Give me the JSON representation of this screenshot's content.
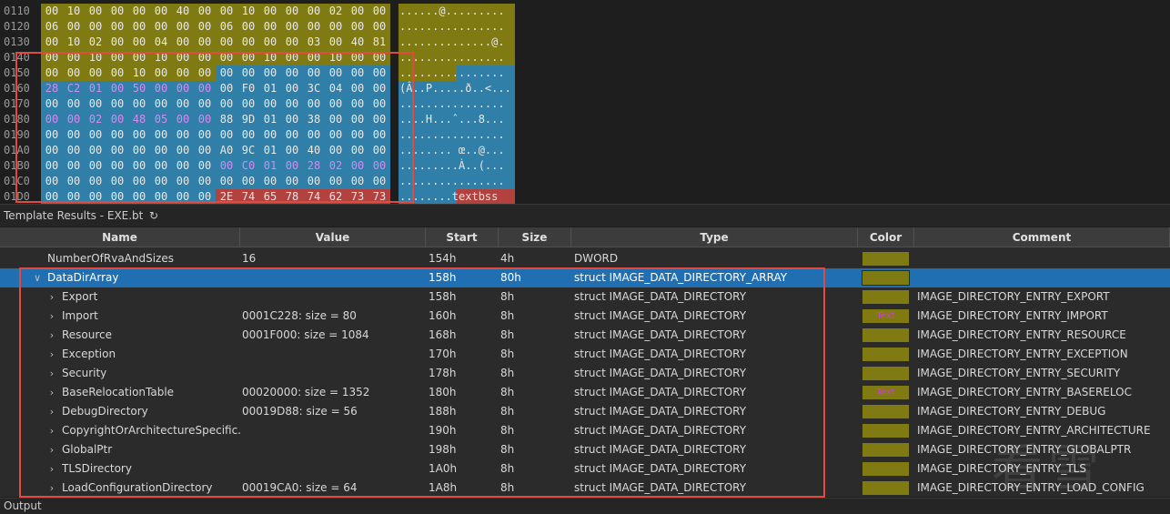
{
  "hex_view": {
    "rows": [
      {
        "addr": "0110",
        "bytes": [
          "00",
          "10",
          "00",
          "00",
          "00",
          "00",
          "40",
          "00",
          "00",
          "10",
          "00",
          "00",
          "00",
          "02",
          "00",
          "00"
        ],
        "ascii": "......@........."
      },
      {
        "addr": "0120",
        "bytes": [
          "06",
          "00",
          "00",
          "00",
          "00",
          "00",
          "00",
          "00",
          "06",
          "00",
          "00",
          "00",
          "00",
          "00",
          "00",
          "00"
        ],
        "ascii": "................"
      },
      {
        "addr": "0130",
        "bytes": [
          "00",
          "10",
          "02",
          "00",
          "00",
          "04",
          "00",
          "00",
          "00",
          "00",
          "00",
          "00",
          "03",
          "00",
          "40",
          "81"
        ],
        "ascii": "..............@."
      },
      {
        "addr": "0140",
        "bytes": [
          "00",
          "00",
          "10",
          "00",
          "00",
          "10",
          "00",
          "00",
          "00",
          "00",
          "10",
          "00",
          "00",
          "10",
          "00",
          "00"
        ],
        "ascii": "................"
      },
      {
        "addr": "0150",
        "bytes": [
          "00",
          "00",
          "00",
          "00",
          "10",
          "00",
          "00",
          "00",
          "00",
          "00",
          "00",
          "00",
          "00",
          "00",
          "00",
          "00"
        ],
        "ascii": "................"
      },
      {
        "addr": "0160",
        "bytes": [
          "28",
          "C2",
          "01",
          "00",
          "50",
          "00",
          "00",
          "00",
          "00",
          "F0",
          "01",
          "00",
          "3C",
          "04",
          "00",
          "00"
        ],
        "ascii": "(Â..P.....ð..<..."
      },
      {
        "addr": "0170",
        "bytes": [
          "00",
          "00",
          "00",
          "00",
          "00",
          "00",
          "00",
          "00",
          "00",
          "00",
          "00",
          "00",
          "00",
          "00",
          "00",
          "00"
        ],
        "ascii": "................"
      },
      {
        "addr": "0180",
        "bytes": [
          "00",
          "00",
          "02",
          "00",
          "48",
          "05",
          "00",
          "00",
          "88",
          "9D",
          "01",
          "00",
          "38",
          "00",
          "00",
          "00"
        ],
        "ascii": "....H...ˆ...8..."
      },
      {
        "addr": "0190",
        "bytes": [
          "00",
          "00",
          "00",
          "00",
          "00",
          "00",
          "00",
          "00",
          "00",
          "00",
          "00",
          "00",
          "00",
          "00",
          "00",
          "00"
        ],
        "ascii": "................"
      },
      {
        "addr": "01A0",
        "bytes": [
          "00",
          "00",
          "00",
          "00",
          "00",
          "00",
          "00",
          "00",
          "A0",
          "9C",
          "01",
          "00",
          "40",
          "00",
          "00",
          "00"
        ],
        "ascii": "........ œ..@..."
      },
      {
        "addr": "01B0",
        "bytes": [
          "00",
          "00",
          "00",
          "00",
          "00",
          "00",
          "00",
          "00",
          "00",
          "C0",
          "01",
          "00",
          "28",
          "02",
          "00",
          "00"
        ],
        "ascii": ".........À..(..."
      },
      {
        "addr": "01C0",
        "bytes": [
          "00",
          "00",
          "00",
          "00",
          "00",
          "00",
          "00",
          "00",
          "00",
          "00",
          "00",
          "00",
          "00",
          "00",
          "00",
          "00"
        ],
        "ascii": "................"
      },
      {
        "addr": "01D0",
        "bytes": [
          "00",
          "00",
          "00",
          "00",
          "00",
          "00",
          "00",
          "00",
          "2E",
          "74",
          "65",
          "78",
          "74",
          "62",
          "73",
          "73"
        ],
        "ascii": "........textbss"
      }
    ],
    "colors": {
      "olive": "#7f7a12",
      "blue": "#2f7fa8",
      "red": "#b3413d",
      "purple_text": "#d28cf2"
    }
  },
  "template": {
    "title": "Template Results - EXE.bt",
    "refresh_icon": "refresh-icon"
  },
  "table": {
    "columns": [
      "Name",
      "Value",
      "Start",
      "Size",
      "Type",
      "Color",
      "Comment"
    ],
    "rows": [
      {
        "name": "NumberOfRvaAndSizes",
        "value": "16",
        "start": "154h",
        "size": "4h",
        "type": "DWORD",
        "comment": "",
        "chevron": "",
        "text": ""
      },
      {
        "name": "DataDirArray",
        "value": "",
        "start": "158h",
        "size": "80h",
        "type": "struct IMAGE_DATA_DIRECTORY_ARRAY",
        "comment": "",
        "chevron": "v",
        "text": ""
      },
      {
        "name": "Export",
        "value": "",
        "start": "158h",
        "size": "8h",
        "type": "struct IMAGE_DATA_DIRECTORY",
        "comment": "IMAGE_DIRECTORY_ENTRY_EXPORT",
        "chevron": ">",
        "text": ""
      },
      {
        "name": "Import",
        "value": "0001C228: size = 80",
        "start": "160h",
        "size": "8h",
        "type": "struct IMAGE_DATA_DIRECTORY",
        "comment": "IMAGE_DIRECTORY_ENTRY_IMPORT",
        "chevron": ">",
        "text": "Text"
      },
      {
        "name": "Resource",
        "value": "0001F000: size = 1084",
        "start": "168h",
        "size": "8h",
        "type": "struct IMAGE_DATA_DIRECTORY",
        "comment": "IMAGE_DIRECTORY_ENTRY_RESOURCE",
        "chevron": ">",
        "text": ""
      },
      {
        "name": "Exception",
        "value": "",
        "start": "170h",
        "size": "8h",
        "type": "struct IMAGE_DATA_DIRECTORY",
        "comment": "IMAGE_DIRECTORY_ENTRY_EXCEPTION",
        "chevron": ">",
        "text": ""
      },
      {
        "name": "Security",
        "value": "",
        "start": "178h",
        "size": "8h",
        "type": "struct IMAGE_DATA_DIRECTORY",
        "comment": "IMAGE_DIRECTORY_ENTRY_SECURITY",
        "chevron": ">",
        "text": ""
      },
      {
        "name": "BaseRelocationTable",
        "value": "00020000: size = 1352",
        "start": "180h",
        "size": "8h",
        "type": "struct IMAGE_DATA_DIRECTORY",
        "comment": "IMAGE_DIRECTORY_ENTRY_BASERELOC",
        "chevron": ">",
        "text": "Text"
      },
      {
        "name": "DebugDirectory",
        "value": "00019D88: size = 56",
        "start": "188h",
        "size": "8h",
        "type": "struct IMAGE_DATA_DIRECTORY",
        "comment": "IMAGE_DIRECTORY_ENTRY_DEBUG",
        "chevron": ">",
        "text": ""
      },
      {
        "name": "CopyrightOrArchitectureSpecific...",
        "value": "",
        "start": "190h",
        "size": "8h",
        "type": "struct IMAGE_DATA_DIRECTORY",
        "comment": "IMAGE_DIRECTORY_ENTRY_ARCHITECTURE",
        "chevron": ">",
        "text": ""
      },
      {
        "name": "GlobalPtr",
        "value": "",
        "start": "198h",
        "size": "8h",
        "type": "struct IMAGE_DATA_DIRECTORY",
        "comment": "IMAGE_DIRECTORY_ENTRY_GLOBALPTR",
        "chevron": ">",
        "text": ""
      },
      {
        "name": "TLSDirectory",
        "value": "",
        "start": "1A0h",
        "size": "8h",
        "type": "struct IMAGE_DATA_DIRECTORY",
        "comment": "IMAGE_DIRECTORY_ENTRY_TLS",
        "chevron": ">",
        "text": ""
      },
      {
        "name": "LoadConfigurationDirectory",
        "value": "00019CA0: size = 64",
        "start": "1A8h",
        "size": "8h",
        "type": "struct IMAGE_DATA_DIRECTORY",
        "comment": "IMAGE_DIRECTORY_ENTRY_LOAD_CONFIG",
        "chevron": ">",
        "text": ""
      }
    ],
    "selected_row": 1
  },
  "watermark": "看雪",
  "output": {
    "label": "Output"
  }
}
